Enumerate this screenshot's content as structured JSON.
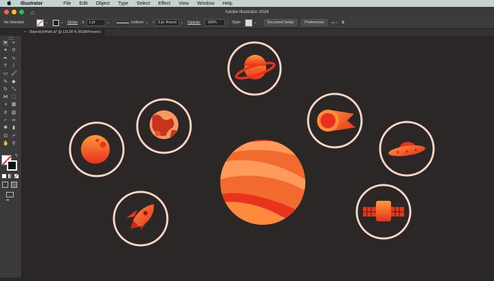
{
  "menubar": {
    "apple": "",
    "app_name": "Illustrator",
    "items": [
      "File",
      "Edit",
      "Object",
      "Type",
      "Select",
      "Effect",
      "View",
      "Window",
      "Help"
    ]
  },
  "window": {
    "title": "Adobe Illustrator 2024",
    "traffic_colors": [
      "#ff5f57",
      "#febc2e",
      "#28c840"
    ]
  },
  "control_bar": {
    "selection": "No Selection",
    "stroke_label": "Stroke",
    "stroke_weight": "1 pt",
    "profile": "Uniform",
    "brush": "3 pt. Round",
    "opacity_label": "Opacity:",
    "opacity_value": "100%",
    "style_label": "Style:",
    "doc_setup": "Document Setup",
    "preferences": "Preferences"
  },
  "document_tab": {
    "close": "×",
    "name": "ObjectsOnPath.ai* @ 115.98 % (RGB/Preview)"
  },
  "toolbar": {
    "icons": [
      "selection-icon",
      "direct-selection-icon",
      "magic-wand-icon",
      "lasso-icon",
      "pen-icon",
      "curvature-icon",
      "type-icon",
      "line-icon",
      "rectangle-icon",
      "paintbrush-icon",
      "pencil-icon",
      "eraser-icon",
      "rotate-icon",
      "scale-icon",
      "width-icon",
      "free-transform-icon",
      "shape-builder-icon",
      "perspective-icon",
      "mesh-icon",
      "gradient-icon",
      "eyedropper-icon",
      "blend-icon",
      "symbol-sprayer-icon",
      "column-graph-icon",
      "artboard-icon",
      "slice-icon",
      "hand-icon",
      "zoom-icon"
    ],
    "more": "•••"
  },
  "canvas": {
    "bg": "#2b2727",
    "ring": "#f7d6c6",
    "orange_light": "#ff8a3d",
    "orange_dark": "#e8341c",
    "objects": [
      "saturn",
      "mars",
      "comet",
      "moon",
      "ufo",
      "rocket",
      "satellite",
      "jupiter"
    ]
  }
}
